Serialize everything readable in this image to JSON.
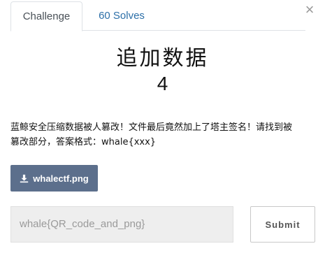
{
  "tabs": {
    "challenge_label": "Challenge",
    "solves_label": "60 Solves"
  },
  "close_icon": "×",
  "challenge": {
    "name": "追加数据",
    "points": "4",
    "description_line1": "蓝鲸安全压缩数据被人篡改！文件最后竟然加上了塔主签名！请找到被",
    "description_line2": "篡改部分，答案格式：whale{xxx}"
  },
  "download": {
    "file_label": "whalectf.png",
    "icon": "download-icon"
  },
  "answer": {
    "value": "whale{QR_code_and_png}"
  },
  "submit_label": "Submit",
  "colors": {
    "download_bg": "#5c6f8c",
    "tab_link": "#2c6fa8",
    "input_bg": "#eeeeee"
  }
}
